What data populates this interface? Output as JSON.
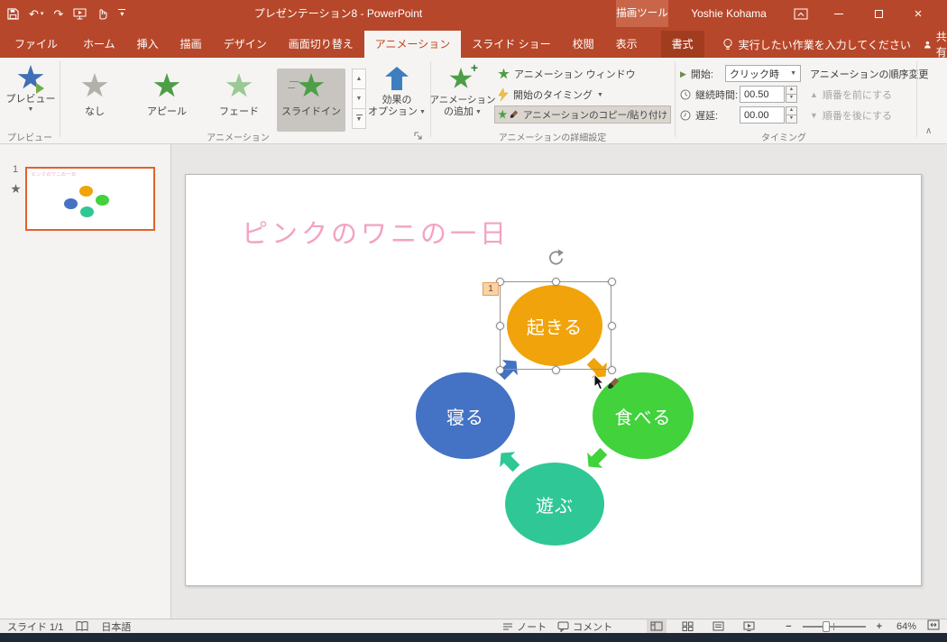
{
  "colors": {
    "titlebar_red": "#B7472A",
    "context_header_red": "#C9664A",
    "contextual_tab_red": "#A23C1F",
    "accent_red": "#C8431F",
    "gallery_selected_bg": "#C8C5C1",
    "painter_active_bg": "#DAD5CF",
    "slide_title_pink": "#F2A3C3",
    "thumb_border_orange": "#E0612E",
    "badge_bg": "#FBD2A3",
    "badge_border": "#E0A05F",
    "taskbar_dark": "#1E2836"
  },
  "titlebar": {
    "title": "プレゼンテーション8 - PowerPoint",
    "context_tool_label": "描画ツール",
    "user_name": "Yoshie Kohama"
  },
  "tabs": {
    "file": "ファイル",
    "items": [
      "ホーム",
      "挿入",
      "描画",
      "デザイン",
      "画面切り替え",
      "アニメーション",
      "スライド ショー",
      "校閲",
      "表示"
    ],
    "contextual": "書式",
    "tell_me": "実行したい作業を入力してください",
    "share_label": "共有"
  },
  "ribbon": {
    "preview_label": "プレビュー",
    "group_preview": "プレビュー",
    "gallery": {
      "none_label": "なし",
      "appear_label": "アピール",
      "fade_label": "フェード",
      "slidein_label": "スライドイン"
    },
    "effect_options_line1": "効果の",
    "effect_options_line2": "オプション",
    "add_animation_line1": "アニメーション",
    "add_animation_line2": "の追加",
    "animation_pane_label": "アニメーション ウィンドウ",
    "trigger_label": "開始のタイミング",
    "painter_label": "アニメーションのコピー/貼り付け",
    "group_animation": "アニメーション",
    "group_advanced": "アニメーションの詳細設定",
    "group_timing": "タイミング",
    "timing": {
      "start_label": "開始:",
      "start_value": "クリック時",
      "duration_label": "継続時間:",
      "duration_value": "00.50",
      "delay_label": "遅延:",
      "delay_value": "00.00"
    },
    "reorder_title": "アニメーションの順序変更",
    "move_earlier_label": "順番を前にする",
    "move_later_label": "順番を後にする"
  },
  "slide_panel": {
    "slide_number": "1"
  },
  "slide": {
    "title": "ピンクのワニの一日",
    "animation_badge": "1",
    "shapes": [
      {
        "label": "起きる",
        "color": "#F0A30A"
      },
      {
        "label": "食べる",
        "color": "#41D23C"
      },
      {
        "label": "遊ぶ",
        "color": "#2FC795"
      },
      {
        "label": "寝る",
        "color": "#4472C4"
      }
    ]
  },
  "statusbar": {
    "slide_indicator": "スライド 1/1",
    "language": "日本語",
    "notes_label": "ノート",
    "comments_label": "コメント",
    "zoom_value": "64%"
  }
}
